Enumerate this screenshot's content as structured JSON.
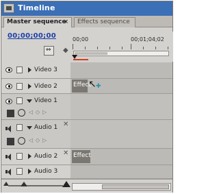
{
  "window": {
    "title": "Timeline"
  },
  "tabs": [
    {
      "label": "Master sequence",
      "close": "×"
    },
    {
      "label": "Effects sequence"
    }
  ],
  "timecode": "00;00;00;00",
  "ruler": {
    "labels": [
      "00;00",
      "00;01;04;02"
    ]
  },
  "tracks": {
    "video3": {
      "name": "Video 3"
    },
    "video2": {
      "name": "Video 2"
    },
    "video1": {
      "name": "Video 1"
    },
    "audio1": {
      "name": "Audio 1"
    },
    "audio2": {
      "name": "Audio 2"
    },
    "audio3": {
      "name": "Audio 3"
    }
  },
  "clips": {
    "video2_clip": "Effect",
    "audio2_clip": "Effect"
  },
  "colors": {
    "title_bar": "#3b6fb6",
    "timecode": "#1a3fa8",
    "cti_region": "#d83a22"
  }
}
